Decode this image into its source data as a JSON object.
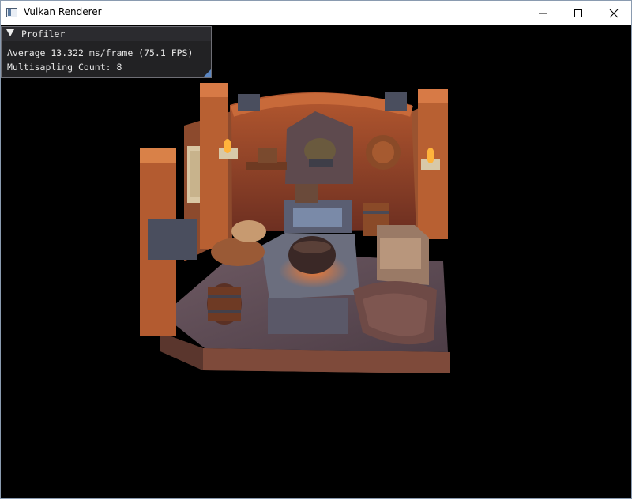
{
  "window": {
    "title": "Vulkan Renderer",
    "icon": "app-window-icon"
  },
  "controls": {
    "minimize": "minimize-icon",
    "maximize": "maximize-icon",
    "close": "close-icon"
  },
  "profiler": {
    "title": "Profiler",
    "line1": "Average 13.322 ms/frame (75.1 FPS)",
    "line2": "Multisapling Count: 8"
  },
  "colors": {
    "background": "#000000",
    "panel": "#28282a",
    "grip": "#5b86c2"
  }
}
